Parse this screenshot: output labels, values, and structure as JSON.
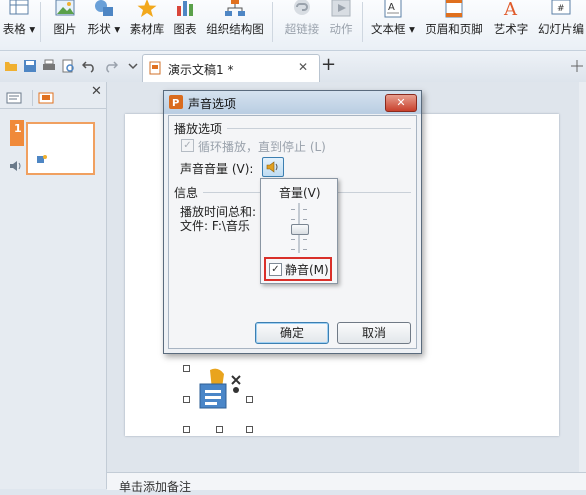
{
  "ribbon": {
    "items": [
      {
        "label": "表格 ▾",
        "icon": "table-icon"
      },
      {
        "label": "图片",
        "icon": "picture-icon"
      },
      {
        "label": "形状 ▾",
        "icon": "shapes-icon"
      },
      {
        "label": "素材库",
        "icon": "star-icon"
      },
      {
        "label": "图表",
        "icon": "chart-icon"
      },
      {
        "label": "组织结构图",
        "icon": "org-chart-icon"
      },
      {
        "label": "超链接",
        "icon": "hyperlink-icon",
        "disabled": true
      },
      {
        "label": "动作",
        "icon": "action-icon",
        "disabled": true
      },
      {
        "label": "文本框 ▾",
        "icon": "textbox-icon"
      },
      {
        "label": "页眉和页脚",
        "icon": "header-footer-icon"
      },
      {
        "label": "艺术字",
        "icon": "wordart-icon"
      },
      {
        "label": "幻灯片编",
        "icon": "slide-number-icon"
      }
    ]
  },
  "tabbar": {
    "doc_tab_label": "演示文稿1 *",
    "close_glyph": "✕",
    "new_tab_glyph": "+"
  },
  "left_panel": {
    "close_glyph": "✕",
    "slide_number": "1"
  },
  "dialog": {
    "title": "声音选项",
    "close_glyph": "✕",
    "playback_group": "播放选项",
    "loop_label": "循环播放，直到停止 (L)",
    "loop_checked": true,
    "volume_label": "声音音量 (V):",
    "info_group": "信息",
    "duration_label": "播放时间总和:",
    "file_label": "文件:  F:\\音乐",
    "ok_label": "确定",
    "cancel_label": "取消"
  },
  "volume_popup": {
    "title": "音量(V)",
    "mute_label": "静音(M)",
    "mute_checked": true
  },
  "notes": {
    "placeholder": "单击添加备注"
  },
  "colors": {
    "accent": "#d9302a",
    "title_bar": "#b9cde2",
    "thumb_border": "#f0a060"
  }
}
